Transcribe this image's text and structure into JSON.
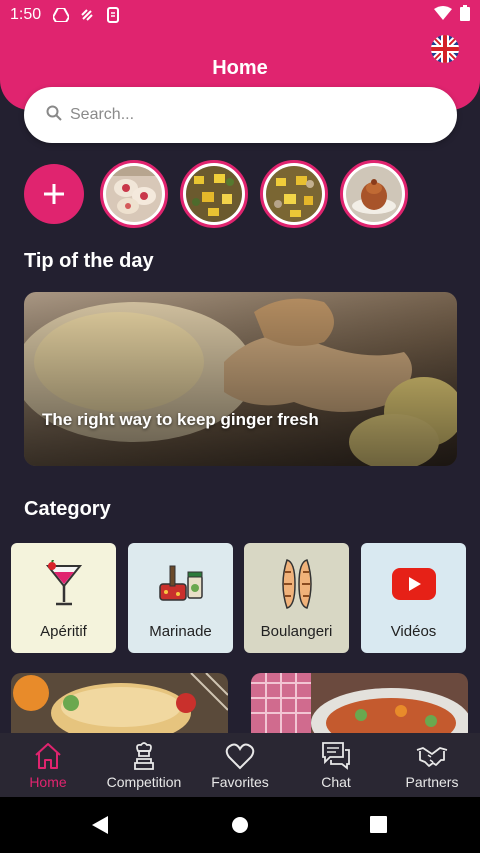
{
  "status": {
    "time": "1:50"
  },
  "header": {
    "title": "Home",
    "language": "en-GB"
  },
  "search": {
    "placeholder": "Search..."
  },
  "stories": {
    "add_label": "+",
    "items": [
      "story-1",
      "story-2",
      "story-3",
      "story-4"
    ]
  },
  "tip": {
    "section_title": "Tip of the day",
    "card_text": "The right way to keep ginger fresh"
  },
  "category": {
    "section_title": "Category",
    "items": [
      {
        "label": "Apéritif",
        "icon": "cocktail-icon",
        "bg": "#F4F3DC"
      },
      {
        "label": "Marinade",
        "icon": "marinade-icon",
        "bg": "#DDEAEE"
      },
      {
        "label": "Boulangeri",
        "icon": "bread-icon",
        "bg": "#D8D7C4"
      },
      {
        "label": "Vidéos",
        "icon": "youtube-icon",
        "bg": "#D9E9F1"
      }
    ]
  },
  "nav": {
    "items": [
      {
        "label": "Home",
        "icon": "home-icon",
        "active": true
      },
      {
        "label": "Competition",
        "icon": "chef-trophy-icon",
        "active": false
      },
      {
        "label": "Favorites",
        "icon": "heart-icon",
        "active": false
      },
      {
        "label": "Chat",
        "icon": "chat-icon",
        "active": false
      },
      {
        "label": "Partners",
        "icon": "handshake-icon",
        "active": false
      }
    ]
  },
  "colors": {
    "accent": "#E0246F",
    "background": "#232030",
    "navbar": "#2A2733"
  }
}
